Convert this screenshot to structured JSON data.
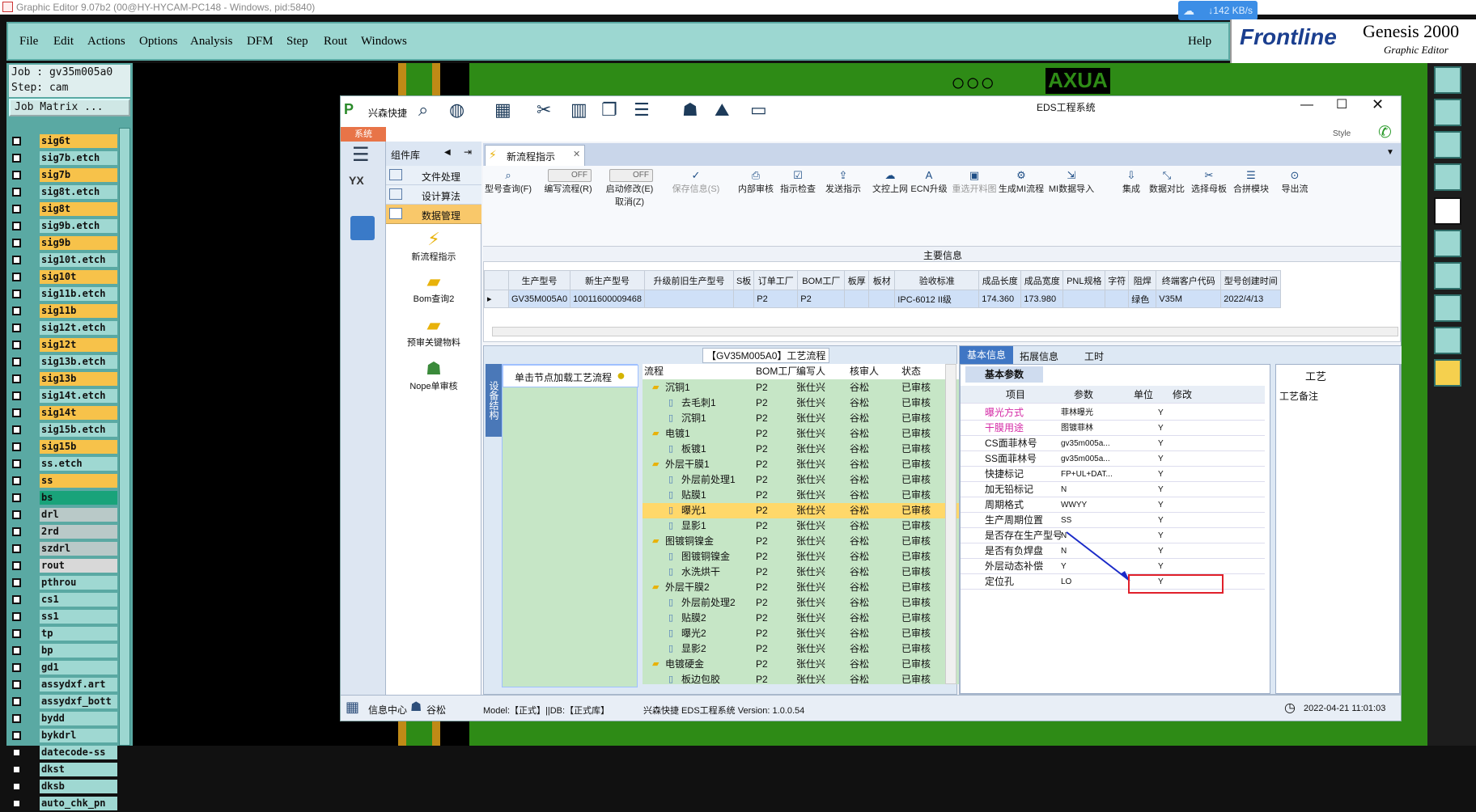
{
  "window_title": "Graphic Editor 9.07b2 (00@HY-HYCAM-PC148 - Windows, pid:5840)",
  "net_speed": "↓142 KB/s",
  "menu": [
    "File",
    "Edit",
    "Actions",
    "Options",
    "Analysis",
    "DFM",
    "Step",
    "Rout",
    "Windows"
  ],
  "help": "Help",
  "brand": {
    "frontline": "Frontline",
    "genesis": "Genesis 2000",
    "sub": "Graphic Editor"
  },
  "job": {
    "line1": "Job : gv35m005a0",
    "line2": "Step: cam",
    "matrix": "Job Matrix ..."
  },
  "layers": [
    {
      "name": "sig6t",
      "color": "#f7c24a"
    },
    {
      "name": "sig7b.etch",
      "color": "#9fd8d2"
    },
    {
      "name": "sig7b",
      "color": "#f7c24a"
    },
    {
      "name": "sig8t.etch",
      "color": "#9fd8d2"
    },
    {
      "name": "sig8t",
      "color": "#f7c24a"
    },
    {
      "name": "sig9b.etch",
      "color": "#9fd8d2"
    },
    {
      "name": "sig9b",
      "color": "#f7c24a"
    },
    {
      "name": "sig10t.etch",
      "color": "#9fd8d2"
    },
    {
      "name": "sig10t",
      "color": "#f7c24a"
    },
    {
      "name": "sig11b.etch",
      "color": "#9fd8d2"
    },
    {
      "name": "sig11b",
      "color": "#f7c24a"
    },
    {
      "name": "sig12t.etch",
      "color": "#9fd8d2"
    },
    {
      "name": "sig12t",
      "color": "#f7c24a"
    },
    {
      "name": "sig13b.etch",
      "color": "#9fd8d2"
    },
    {
      "name": "sig13b",
      "color": "#f7c24a"
    },
    {
      "name": "sig14t.etch",
      "color": "#9fd8d2"
    },
    {
      "name": "sig14t",
      "color": "#f7c24a"
    },
    {
      "name": "sig15b.etch",
      "color": "#9fd8d2"
    },
    {
      "name": "sig15b",
      "color": "#f7c24a"
    },
    {
      "name": "ss.etch",
      "color": "#9fd8d2"
    },
    {
      "name": "ss",
      "color": "#f7c24a"
    },
    {
      "name": "bs",
      "color": "#19a37a"
    },
    {
      "name": "drl",
      "color": "#b9c9c8"
    },
    {
      "name": "2rd",
      "color": "#b9c9c8"
    },
    {
      "name": "szdrl",
      "color": "#b9c9c8"
    },
    {
      "name": "rout",
      "color": "#d8d8d8"
    },
    {
      "name": "pthrou",
      "color": "#9fd8d2"
    },
    {
      "name": "cs1",
      "color": "#9fd8d2"
    },
    {
      "name": "ss1",
      "color": "#9fd8d2"
    },
    {
      "name": "tp",
      "color": "#9fd8d2"
    },
    {
      "name": "bp",
      "color": "#9fd8d2"
    },
    {
      "name": "gd1",
      "color": "#9fd8d2"
    },
    {
      "name": "assydxf.art",
      "color": "#9fd8d2"
    },
    {
      "name": "assydxf_bott",
      "color": "#9fd8d2"
    },
    {
      "name": "bydd",
      "color": "#9fd8d2"
    },
    {
      "name": "bykdrl",
      "color": "#9fd8d2"
    },
    {
      "name": "datecode-ss",
      "color": "#9fd8d2"
    },
    {
      "name": "dkst",
      "color": "#9fd8d2"
    },
    {
      "name": "dksb",
      "color": "#9fd8d2"
    },
    {
      "name": "auto_chk_pn",
      "color": "#9fd8d2"
    }
  ],
  "canvas_text": "AXUA",
  "eds": {
    "app_name": "兴森快捷",
    "title": "EDS工程系统",
    "style": "Style",
    "sys_tab": "系统",
    "component_lib": "组件库",
    "side_nav": [
      "文件处理",
      "设计算法",
      "数据管理"
    ],
    "side_items": [
      "新流程指示",
      "Bom查询2",
      "预审关键物料",
      "Nope单审核"
    ],
    "doc_tab": "新流程指示",
    "ribbon": [
      {
        "icon": "⌕",
        "label": "型号查询(F)"
      },
      {
        "icon": "",
        "label": "编写流程(R)"
      },
      {
        "icon": "",
        "label": "启动修改(E)\n取消(Z)"
      },
      {
        "icon": "✓",
        "label": "保存信息(S)"
      },
      {
        "icon": "⎙",
        "label": "内部审核"
      },
      {
        "icon": "☑",
        "label": "指示检查"
      },
      {
        "icon": "⇪",
        "label": "发送指示"
      },
      {
        "icon": "☁",
        "label": "文控上网"
      },
      {
        "icon": "A",
        "label": "ECN升级"
      },
      {
        "icon": "▣",
        "label": "重选开料图"
      },
      {
        "icon": "⚙",
        "label": "生成MI流程"
      },
      {
        "icon": "⇲",
        "label": "MI数据导入"
      },
      {
        "icon": "⇩",
        "label": "集成"
      },
      {
        "icon": "⤡",
        "label": "数据对比"
      },
      {
        "icon": "✂",
        "label": "选择母板"
      },
      {
        "icon": "☰",
        "label": "合拼模块"
      },
      {
        "icon": "⊙",
        "label": "导出流"
      }
    ],
    "toggles": [
      "OFF",
      "OFF"
    ],
    "main_info": "主要信息",
    "info_cols": [
      "生产型号",
      "新生产型号",
      "升级前旧生产型号",
      "S板",
      "订单工厂",
      "BOM工厂",
      "板厚",
      "板材",
      "验收标准",
      "成品长度",
      "成品宽度",
      "PNL规格",
      "字符",
      "阻焊",
      "终端客户代码",
      "型号创建时间"
    ],
    "info_row": [
      "GV35M005A0",
      "10011600009468",
      "",
      "",
      "P2",
      "P2",
      "",
      "",
      "IPC-6012 II级",
      "174.360",
      "173.980",
      "",
      "",
      "绿色",
      "V35M",
      "2022/4/13"
    ],
    "flow_title": "【GV35M005A0】工艺流程",
    "flow_side_tab": "设备结构",
    "flow_hint": "单击节点加载工艺流程",
    "flow_cols": [
      "流程",
      "BOM工厂",
      "编写人",
      "核审人",
      "状态"
    ],
    "flow_rows": [
      {
        "n": "沉铜1",
        "l": 1,
        "b": "P2",
        "w": "张仕兴",
        "r": "谷松",
        "s": "已审核"
      },
      {
        "n": "去毛刺1",
        "l": 2,
        "b": "P2",
        "w": "张仕兴",
        "r": "谷松",
        "s": "已审核"
      },
      {
        "n": "沉铜1",
        "l": 2,
        "b": "P2",
        "w": "张仕兴",
        "r": "谷松",
        "s": "已审核"
      },
      {
        "n": "电镀1",
        "l": 1,
        "b": "P2",
        "w": "张仕兴",
        "r": "谷松",
        "s": "已审核"
      },
      {
        "n": "板镀1",
        "l": 2,
        "b": "P2",
        "w": "张仕兴",
        "r": "谷松",
        "s": "已审核"
      },
      {
        "n": "外层干膜1",
        "l": 1,
        "b": "P2",
        "w": "张仕兴",
        "r": "谷松",
        "s": "已审核"
      },
      {
        "n": "外层前处理1",
        "l": 2,
        "b": "P2",
        "w": "张仕兴",
        "r": "谷松",
        "s": "已审核"
      },
      {
        "n": "贴膜1",
        "l": 2,
        "b": "P2",
        "w": "张仕兴",
        "r": "谷松",
        "s": "已审核"
      },
      {
        "n": "曝光1",
        "l": 2,
        "b": "P2",
        "w": "张仕兴",
        "r": "谷松",
        "s": "已审核",
        "sel": true
      },
      {
        "n": "显影1",
        "l": 2,
        "b": "P2",
        "w": "张仕兴",
        "r": "谷松",
        "s": "已审核"
      },
      {
        "n": "图镀铜镍金",
        "l": 1,
        "b": "P2",
        "w": "张仕兴",
        "r": "谷松",
        "s": "已审核"
      },
      {
        "n": "图镀铜镍金",
        "l": 2,
        "b": "P2",
        "w": "张仕兴",
        "r": "谷松",
        "s": "已审核"
      },
      {
        "n": "水洗烘干",
        "l": 2,
        "b": "P2",
        "w": "张仕兴",
        "r": "谷松",
        "s": "已审核"
      },
      {
        "n": "外层干膜2",
        "l": 1,
        "b": "P2",
        "w": "张仕兴",
        "r": "谷松",
        "s": "已审核"
      },
      {
        "n": "外层前处理2",
        "l": 2,
        "b": "P2",
        "w": "张仕兴",
        "r": "谷松",
        "s": "已审核"
      },
      {
        "n": "贴膜2",
        "l": 2,
        "b": "P2",
        "w": "张仕兴",
        "r": "谷松",
        "s": "已审核"
      },
      {
        "n": "曝光2",
        "l": 2,
        "b": "P2",
        "w": "张仕兴",
        "r": "谷松",
        "s": "已审核"
      },
      {
        "n": "显影2",
        "l": 2,
        "b": "P2",
        "w": "张仕兴",
        "r": "谷松",
        "s": "已审核"
      },
      {
        "n": "电镀硬金",
        "l": 1,
        "b": "P2",
        "w": "张仕兴",
        "r": "谷松",
        "s": "已审核"
      },
      {
        "n": "板边包胶",
        "l": 2,
        "b": "P2",
        "w": "张仕兴",
        "r": "谷松",
        "s": "已审核"
      }
    ],
    "info_tabs": [
      "基本信息",
      "拓展信息",
      "工时"
    ],
    "basic_params": "基本参数",
    "param_cols": [
      "项目",
      "参数",
      "单位",
      "修改"
    ],
    "params": [
      {
        "item": "曝光方式",
        "value": "菲林曝光",
        "mod": "Y",
        "color": "#d42aa6"
      },
      {
        "item": "干膜用途",
        "value": "图镀菲林",
        "mod": "Y",
        "color": "#d42aa6"
      },
      {
        "item": "CS面菲林号",
        "value": "gv35m005a...",
        "mod": "Y"
      },
      {
        "item": "SS面菲林号",
        "value": "gv35m005a...",
        "mod": "Y"
      },
      {
        "item": "快捷标记",
        "value": "FP+UL+DAT...",
        "mod": "Y"
      },
      {
        "item": "加无铅标记",
        "value": "N",
        "mod": "Y"
      },
      {
        "item": "周期格式",
        "value": "WWYY",
        "mod": "Y"
      },
      {
        "item": "生产周期位置",
        "value": "SS",
        "mod": "Y"
      },
      {
        "item": "是否存在生产型号",
        "value": "N",
        "mod": "Y"
      },
      {
        "item": "是否有负焊盘",
        "value": "N",
        "mod": "Y"
      },
      {
        "item": "外层动态补偿",
        "value": "Y",
        "mod": "Y"
      },
      {
        "item": "定位孔",
        "value": "LO",
        "mod": "Y"
      }
    ],
    "craft_panel": {
      "title": "工艺",
      "note": "工艺备注"
    },
    "status": {
      "info": "信息中心",
      "user": "谷松",
      "model": "Model:【正式】||DB:【正式库】",
      "app": "兴森快捷 EDS工程系统 Version: 1.0.0.54",
      "time": "2022-04-21 11:01:03"
    }
  }
}
